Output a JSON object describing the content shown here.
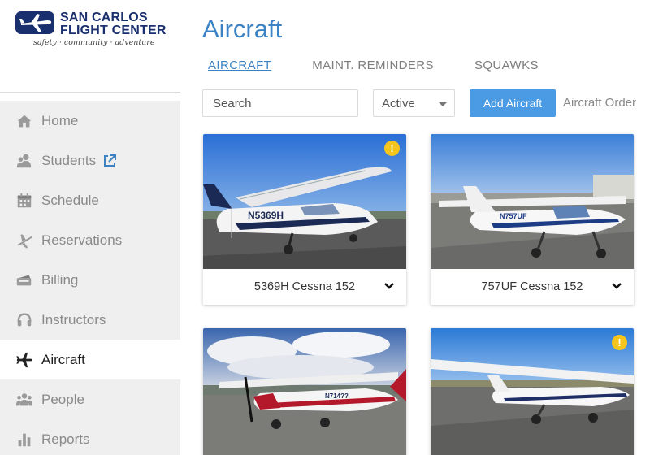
{
  "brand": {
    "line1": "SAN CARLOS",
    "line2": "FLIGHT CENTER",
    "tagline": "safety · community · adventure",
    "color": "#1a2f6e"
  },
  "sidebar": {
    "items": [
      {
        "label": "Home",
        "icon": "home-icon"
      },
      {
        "label": "Students",
        "icon": "users-icon",
        "external": true
      },
      {
        "label": "Schedule",
        "icon": "calendar-icon"
      },
      {
        "label": "Reservations",
        "icon": "plane-takeoff-icon"
      },
      {
        "label": "Billing",
        "icon": "money-icon"
      },
      {
        "label": "Instructors",
        "icon": "headset-icon"
      },
      {
        "label": "Aircraft",
        "icon": "airplane-icon",
        "active": true
      },
      {
        "label": "People",
        "icon": "group-icon"
      },
      {
        "label": "Reports",
        "icon": "bar-chart-icon"
      }
    ]
  },
  "main": {
    "title": "Aircraft",
    "tabs": [
      {
        "label": "AIRCRAFT",
        "active": true
      },
      {
        "label": "MAINT. REMINDERS"
      },
      {
        "label": "SQUAWKS"
      }
    ],
    "search": {
      "placeholder": "Search"
    },
    "status_select": {
      "value": "Active"
    },
    "add_button": "Add Aircraft",
    "order_link": "Aircraft Order",
    "accent_color": "#3a82c4",
    "button_color": "#4a9be3",
    "warning_color": "#f5c51d"
  },
  "aircraft": [
    {
      "name": "5369H Cessna 152",
      "tail_marking": "N5369H",
      "warning": true,
      "warning_glyph": "!"
    },
    {
      "name": "757UF Cessna 152",
      "tail_marking": "N757UF",
      "warning": false
    },
    {
      "name": "",
      "tail_marking": "N714??",
      "warning": false
    },
    {
      "name": "",
      "tail_marking": "",
      "warning": true,
      "warning_glyph": "!"
    }
  ]
}
